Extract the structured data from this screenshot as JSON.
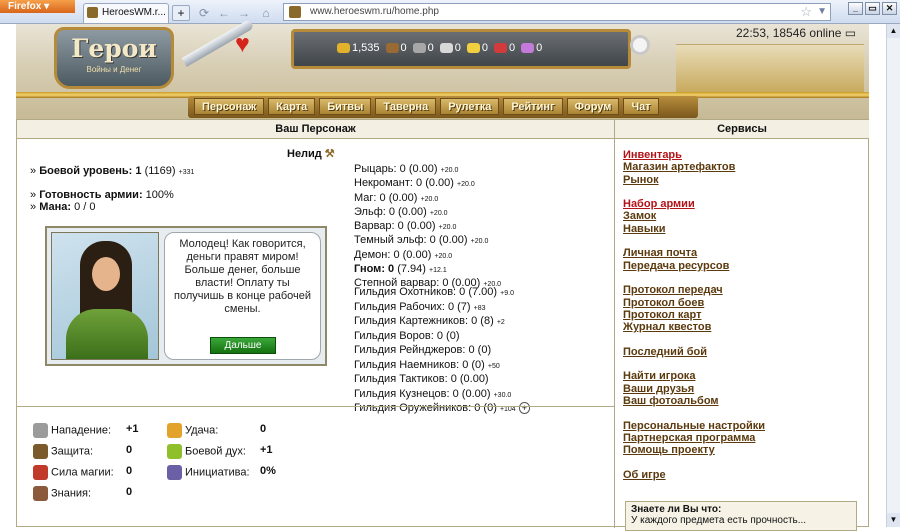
{
  "browser": {
    "menu_label": "Firefox",
    "tab_title": "HeroesWM.r...",
    "new_tab": "+",
    "url": "www.heroeswm.ru/home.php",
    "win_buttons": [
      "_",
      "▭",
      "✕"
    ]
  },
  "header": {
    "logo_title": "Герои",
    "logo_subtitle": "Войны и Денег",
    "clock": "22:53, 18546 online",
    "resources": [
      {
        "icon": "gold-icon",
        "value": "1,535",
        "color": "#e2b22b"
      },
      {
        "icon": "wood-icon",
        "value": "0",
        "color": "#9a6a34"
      },
      {
        "icon": "ore-icon",
        "value": "0",
        "color": "#a7a7a7"
      },
      {
        "icon": "mercury-icon",
        "value": "0",
        "color": "#d7d7d7"
      },
      {
        "icon": "sulfur-icon",
        "value": "0",
        "color": "#f0d040"
      },
      {
        "icon": "crystal-icon",
        "value": "0",
        "color": "#d23b3b"
      },
      {
        "icon": "gems-icon",
        "value": "0",
        "color": "#c47ad8"
      }
    ]
  },
  "nav": [
    "Персонаж",
    "Карта",
    "Битвы",
    "Таверна",
    "Рулетка",
    "Рейтинг",
    "Форум",
    "Чат"
  ],
  "panels": {
    "left_title": "Ваш Персонаж",
    "right_title": "Сервисы"
  },
  "character": {
    "name": "Нелид",
    "combat_label": "Боевой уровень:",
    "combat_value": "1",
    "combat_exp": "(1169)",
    "combat_extra": "+331",
    "army_label": "Готовность армии:",
    "army_value": "100%",
    "mana_label": "Мана:",
    "mana_value": "0 / 0"
  },
  "dialog": {
    "text": "Молодец! Как говорится, деньги правят миром! Больше денег, больше власти! Оплату ты получишь в конце рабочей смены.",
    "button": "Дальше"
  },
  "skills": [
    {
      "label": "Рыцарь:",
      "value": "0 (0.00)",
      "extra": "+20.0",
      "bold": false
    },
    {
      "label": "Некромант:",
      "value": "0 (0.00)",
      "extra": "+20.0",
      "bold": false
    },
    {
      "label": "Маг:",
      "value": "0 (0.00)",
      "extra": "+20.0",
      "bold": false
    },
    {
      "label": "Эльф:",
      "value": "0 (0.00)",
      "extra": "+20.0",
      "bold": false
    },
    {
      "label": "Варвар:",
      "value": "0 (0.00)",
      "extra": "+20.0",
      "bold": false
    },
    {
      "label": "Темный эльф:",
      "value": "0 (0.00)",
      "extra": "+20.0",
      "bold": false
    },
    {
      "label": "Демон:",
      "value": "0 (0.00)",
      "extra": "+20.0",
      "bold": false
    },
    {
      "label": "Гном: 0",
      "value": "(7.94)",
      "extra": "+12.1",
      "bold": true
    },
    {
      "label": "Степной варвар:",
      "value": "0 (0.00)",
      "extra": "+20.0",
      "bold": false
    }
  ],
  "guilds": [
    {
      "label": "Гильдия Охотников:",
      "value": "0 (7.00)",
      "extra": "+9.0"
    },
    {
      "label": "Гильдия Рабочих:",
      "value": "0 (7)",
      "extra": "+83"
    },
    {
      "label": "Гильдия Картежников:",
      "value": "0 (8)",
      "extra": "+2"
    },
    {
      "label": "Гильдия Воров:",
      "value": "0 (0)",
      "extra": ""
    },
    {
      "label": "Гильдия Рейнджеров:",
      "value": "0 (0)",
      "extra": ""
    },
    {
      "label": "Гильдия Наемников:",
      "value": "0 (0)",
      "extra": "+50"
    },
    {
      "label": "Гильдия Тактиков:",
      "value": "0 (0.00)",
      "extra": ""
    },
    {
      "label": "Гильдия Кузнецов:",
      "value": "0 (0.00)",
      "extra": "+30.0"
    },
    {
      "label": "Гильдия Оружейников:",
      "value": "0 (0)",
      "extra": "+104"
    }
  ],
  "guild_plus": "+",
  "attributes": [
    {
      "icon": "attack-icon",
      "label": "Нападение:",
      "value": "+1",
      "color": "#9b9b9b"
    },
    {
      "icon": "defense-icon",
      "label": "Защита:",
      "value": "0",
      "color": "#7a5a2a"
    },
    {
      "icon": "magic-icon",
      "label": "Сила магии:",
      "value": "0",
      "color": "#c0392b"
    },
    {
      "icon": "knowledge-icon",
      "label": "Знания:",
      "value": "0",
      "color": "#8b5a3c"
    },
    {
      "icon": "luck-icon",
      "label": "Удача:",
      "value": "0",
      "color": "#e3a22a"
    },
    {
      "icon": "morale-icon",
      "label": "Боевой дух:",
      "value": "+1",
      "color": "#8fbf2a"
    },
    {
      "icon": "initiative-icon",
      "label": "Инициатива:",
      "value": "0%",
      "color": "#6b5fa6"
    }
  ],
  "services": [
    {
      "label": "Инвентарь",
      "red": true
    },
    {
      "label": "Магазин артефактов"
    },
    {
      "label": "Рынок"
    },
    {
      "gap": true
    },
    {
      "label": "Набор армии",
      "red": true
    },
    {
      "label": "Замок"
    },
    {
      "label": "Навыки"
    },
    {
      "gap": true
    },
    {
      "label": "Личная почта"
    },
    {
      "label": "Передача ресурсов"
    },
    {
      "gap": true
    },
    {
      "label": "Протокол передач"
    },
    {
      "label": "Протокол боев"
    },
    {
      "label": "Протокол карт"
    },
    {
      "label": "Журнал квестов"
    },
    {
      "gap": true
    },
    {
      "label": "Последний бой"
    },
    {
      "gap": true
    },
    {
      "label": "Найти игрока"
    },
    {
      "label": "Ваши друзья"
    },
    {
      "label": "Ваш фотоальбом"
    },
    {
      "gap": true
    },
    {
      "label": "Персональные настройки"
    },
    {
      "label": "Партнерская программа"
    },
    {
      "label": "Помощь проекту"
    },
    {
      "gap": true
    },
    {
      "label": "Об игре"
    }
  ],
  "tip": {
    "title": "Знаете ли Вы что:",
    "text": "У каждого предмета есть прочность..."
  }
}
